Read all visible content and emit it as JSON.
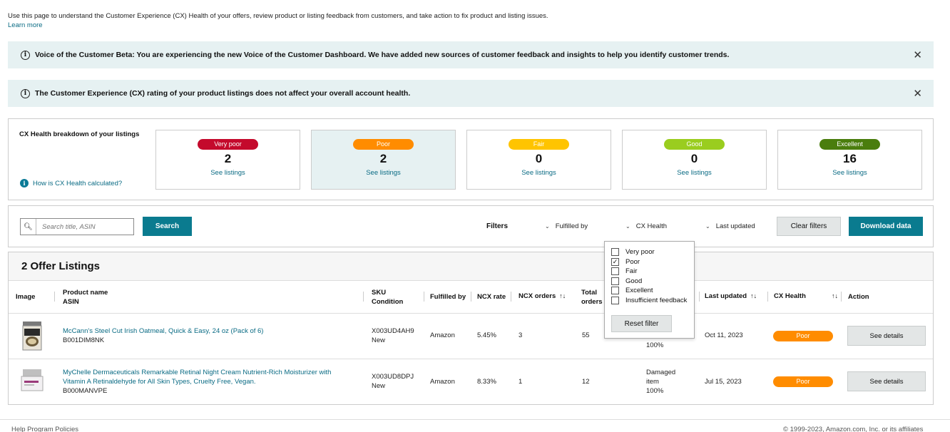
{
  "intro": {
    "text": "Use this page to understand the Customer Experience (CX) Health of your offers, review product or listing feedback from customers, and take action to fix product and listing issues.",
    "learn_more": "Learn more"
  },
  "banners": [
    {
      "text": "Voice of the Customer Beta: You are experiencing the new Voice of the Customer Dashboard. We have added new sources of customer feedback and insights to help you identify customer trends."
    },
    {
      "text": "The Customer Experience (CX) rating of your product listings does not affect your overall account health."
    }
  ],
  "breakdown": {
    "title": "CX Health breakdown of your listings",
    "help_link": "How is CX Health calculated?",
    "cards": [
      {
        "label": "Very poor",
        "count": "2",
        "link": "See listings",
        "color": "#c40a2c"
      },
      {
        "label": "Poor",
        "count": "2",
        "link": "See listings",
        "color": "#ff8c00"
      },
      {
        "label": "Fair",
        "count": "0",
        "link": "See listings",
        "color": "#ffc400"
      },
      {
        "label": "Good",
        "count": "0",
        "link": "See listings",
        "color": "#9acd1f"
      },
      {
        "label": "Excellent",
        "count": "16",
        "link": "See listings",
        "color": "#4a7d0d"
      }
    ]
  },
  "toolbar": {
    "search_placeholder": "Search title, ASIN",
    "search_button": "Search",
    "filters_label": "Filters",
    "fulfilled_by": "Fulfilled by",
    "cx_health": "CX Health",
    "last_updated": "Last updated",
    "clear_filters": "Clear filters",
    "download": "Download data"
  },
  "cx_filter": {
    "options": [
      {
        "label": "Very poor",
        "checked": false
      },
      {
        "label": "Poor",
        "checked": true
      },
      {
        "label": "Fair",
        "checked": false
      },
      {
        "label": "Good",
        "checked": false
      },
      {
        "label": "Excellent",
        "checked": false
      },
      {
        "label": "Insufficient feedback",
        "checked": false
      }
    ],
    "reset": "Reset filter"
  },
  "listings": {
    "title": "2 Offer Listings",
    "columns": {
      "image": "Image",
      "product_name": "Product name",
      "asin": "ASIN",
      "sku": "SKU",
      "condition": "Condition",
      "fulfilled_by": "Fulfilled by",
      "ncx_rate": "NCX rate",
      "ncx_orders": "NCX orders",
      "total_orders_1": "Total",
      "total_orders_2": "orders",
      "last_updated": "Last updated",
      "cx_health": "CX Health",
      "action": "Action"
    },
    "rows": [
      {
        "product": "McCann's Steel Cut Irish Oatmeal, Quick & Easy, 24 oz (Pack of 6)",
        "asin": "B001DIM8NK",
        "sku": "X003UD4AH9",
        "condition": "New",
        "fulfilled_by": "Amazon",
        "ncx_rate": "5.45%",
        "ncx_orders": "3",
        "total_orders": "55",
        "return_pct": "100%",
        "last_updated": "Oct 11, 2023",
        "cx_health": "Poor",
        "action": "See details"
      },
      {
        "product_line1": "MyChelle Dermaceuticals Remarkable Retinal Night Cream Nutrient-Rich Moisturizer with",
        "product_line2": "Vitamin A Retinaldehyde for All Skin Types, Cruelty Free, Vegan.",
        "asin": "B000MANVPE",
        "sku": "X003UD8DPJ",
        "condition": "New",
        "fulfilled_by": "Amazon",
        "ncx_rate": "8.33%",
        "ncx_orders": "1",
        "total_orders": "12",
        "return_1": "Damaged",
        "return_2": "item",
        "return_pct": "100%",
        "last_updated": "Jul 15, 2023",
        "cx_health": "Poor",
        "action": "See details"
      }
    ]
  },
  "footer": {
    "left": "Help   Program Policies",
    "copyright": "© 1999-2023, Amazon.com, Inc. or its affiliates"
  }
}
